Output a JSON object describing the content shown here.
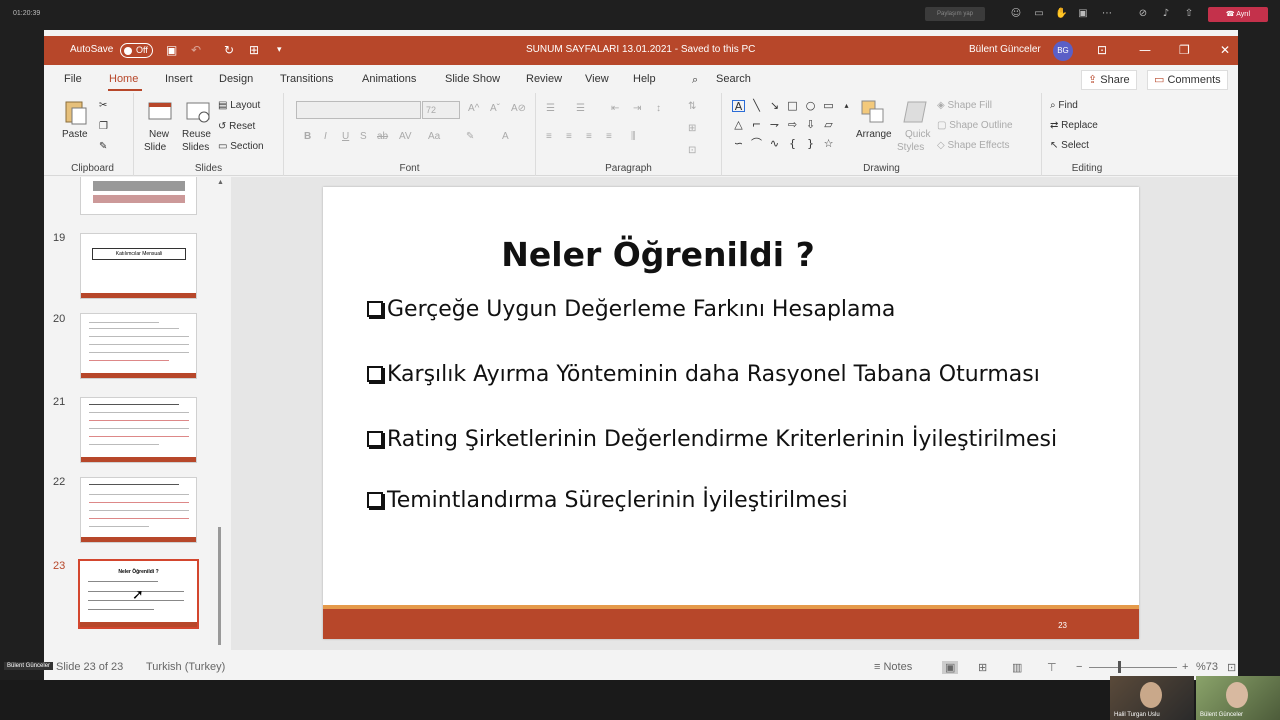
{
  "meeting": {
    "timer": "01:20:39",
    "leave_label": "Ayrıl",
    "grey_button": "Paylaşım yap",
    "presenter_tag": "Bülent Günceler",
    "participants": [
      {
        "name": "Halil Turgan Uslu"
      },
      {
        "name": "Bülent Günceler"
      }
    ]
  },
  "window": {
    "autosave_label": "AutoSave",
    "autosave_state": "Off",
    "title": "SUNUM SAYFALARI 13.01.2021  -  Saved to this PC",
    "user_name": "Bülent Günceler",
    "user_initials": "BG"
  },
  "menu": {
    "tabs": [
      "File",
      "Home",
      "Insert",
      "Design",
      "Transitions",
      "Animations",
      "Slide Show",
      "Review",
      "View",
      "Help"
    ],
    "active": "Home",
    "search": "Search",
    "share": "Share",
    "comments": "Comments"
  },
  "ribbon": {
    "clipboard": {
      "label": "Clipboard",
      "paste": "Paste"
    },
    "slides": {
      "label": "Slides",
      "new_slide_1": "New",
      "new_slide_2": "Slide",
      "reuse_1": "Reuse",
      "reuse_2": "Slides",
      "layout": "Layout",
      "reset": "Reset",
      "section": "Section"
    },
    "font": {
      "label": "Font",
      "size": "72"
    },
    "paragraph": {
      "label": "Paragraph"
    },
    "drawing": {
      "label": "Drawing",
      "arrange": "Arrange",
      "quick_styles_1": "Quick",
      "quick_styles_2": "Styles",
      "shape_fill": "Shape Fill",
      "shape_outline": "Shape Outline",
      "shape_effects": "Shape Effects"
    },
    "editing": {
      "label": "Editing",
      "find": "Find",
      "replace": "Replace",
      "select": "Select"
    }
  },
  "thumbnails": [
    {
      "num": "19",
      "title": "Katılımcılar Mensuali"
    },
    {
      "num": "20"
    },
    {
      "num": "21"
    },
    {
      "num": "22"
    },
    {
      "num": "23",
      "title": "Neler Öğrenildi ?",
      "selected": true
    }
  ],
  "slide": {
    "title": "Neler Öğrenildi ?",
    "bullets": [
      "Gerçeğe Uygun Değerleme Farkını Hesaplama",
      "Karşılık Ayırma Yönteminin daha Rasyonel Tabana Oturması",
      "Rating Şirketlerinin Değerlendirme Kriterlerinin İyileştirilmesi",
      "Temintlandırma Süreçlerinin İyileştirilmesi"
    ],
    "number": "23",
    "accent": "#b7472a"
  },
  "status": {
    "slide_info": "Slide 23 of 23",
    "language": "Turkish (Turkey)",
    "notes": "Notes",
    "zoom": "%73"
  }
}
